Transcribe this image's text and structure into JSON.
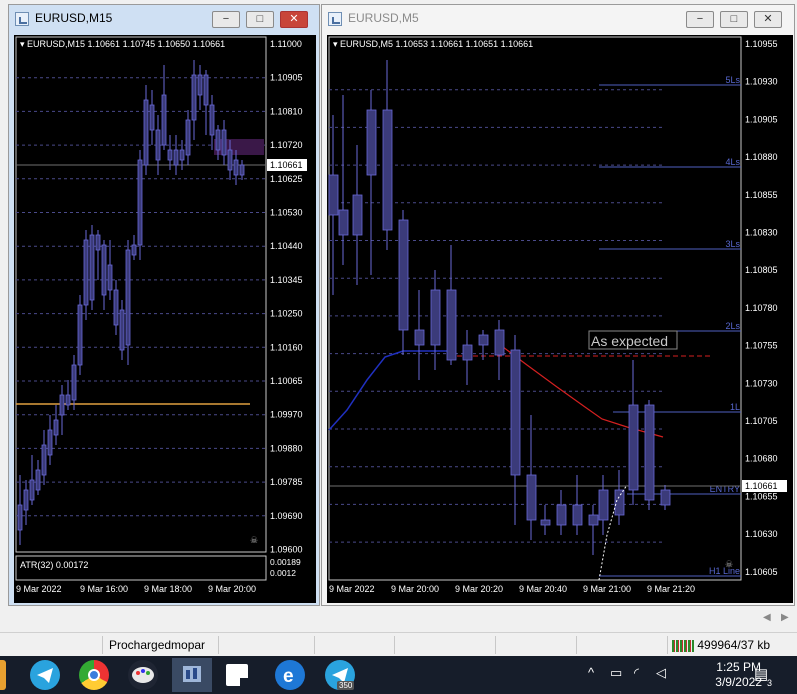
{
  "left_window": {
    "title": "EURUSD,M15",
    "chart_header": "▾ EURUSD,M15  1.10661 1.10745 1.10650 1.10661",
    "price_labels": [
      "1.11000",
      "1.10905",
      "1.10810",
      "1.10720",
      "1.10625",
      "1.10530",
      "1.10440",
      "1.10345",
      "1.10250",
      "1.10160",
      "1.10065",
      "1.09970",
      "1.09880",
      "1.09785",
      "1.09690",
      "1.09600"
    ],
    "current_price": "1.10661",
    "indicator_label": "ATR(32) 0.00172",
    "indicator_scale": [
      "0.00189",
      "0.0012"
    ],
    "time_labels": [
      "9 Mar 2022",
      "9 Mar 16:00",
      "9 Mar 18:00",
      "9 Mar 20:00"
    ]
  },
  "right_window": {
    "title": "EURUSD,M5",
    "chart_header": "▾ EURUSD,M5  1.10653 1.10661 1.10651 1.10661",
    "price_labels": [
      "1.10955",
      "1.10930",
      "1.10905",
      "1.10880",
      "1.10855",
      "1.10830",
      "1.10805",
      "1.10780",
      "1.10755",
      "1.10730",
      "1.10705",
      "1.10680",
      "1.10655",
      "1.10630",
      "1.10605"
    ],
    "current_price": "1.10661",
    "level_labels": [
      "5Ls",
      "4Ls",
      "3Ls",
      "2Ls",
      "1L",
      "ENTRY",
      "H1 Line"
    ],
    "annotation": "As expected",
    "time_labels": [
      "9 Mar 2022",
      "9 Mar 20:00",
      "9 Mar 20:20",
      "9 Mar 20:40",
      "9 Mar 21:00",
      "9 Mar 21:20"
    ]
  },
  "window_buttons": {
    "minimize": "−",
    "maximize": "□",
    "close": "✕"
  },
  "status_bar": {
    "profile": "Prochargedmopar",
    "traffic": "499964/37 kb"
  },
  "taskbar": {
    "time": "1:25 PM",
    "date": "3/9/2022",
    "notification_count": "3",
    "telegram_badge": "350"
  },
  "colors": {
    "candle_fill": "#3b3b7a",
    "candle_line": "#6a6ad8",
    "grid": "#4a4a8a",
    "orange_line": "#e0a040",
    "red_ma": "#d42020",
    "blue_ma": "#2030c0"
  }
}
